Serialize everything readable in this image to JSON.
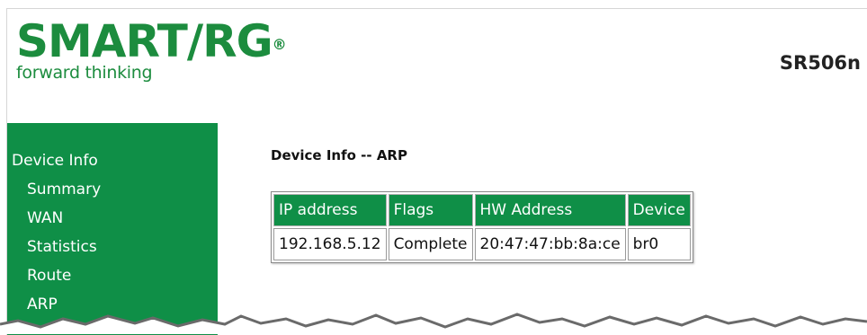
{
  "brand": {
    "logo_text": "SMART/RG",
    "registered_mark": "®",
    "tagline": "forward thinking",
    "color": "#1c8c3e"
  },
  "header": {
    "model": "SR506n"
  },
  "sidebar": {
    "background": "#0f8f47",
    "section_title": "Device Info",
    "items": [
      {
        "label": "Summary"
      },
      {
        "label": "WAN"
      },
      {
        "label": "Statistics"
      },
      {
        "label": "Route"
      },
      {
        "label": "ARP"
      }
    ]
  },
  "main": {
    "title": "Device Info -- ARP",
    "table": {
      "columns": [
        "IP address",
        "Flags",
        "HW Address",
        "Device"
      ],
      "rows": [
        [
          "192.168.5.12",
          "Complete",
          "20:47:47:bb:8a:ce",
          "br0"
        ]
      ]
    }
  }
}
